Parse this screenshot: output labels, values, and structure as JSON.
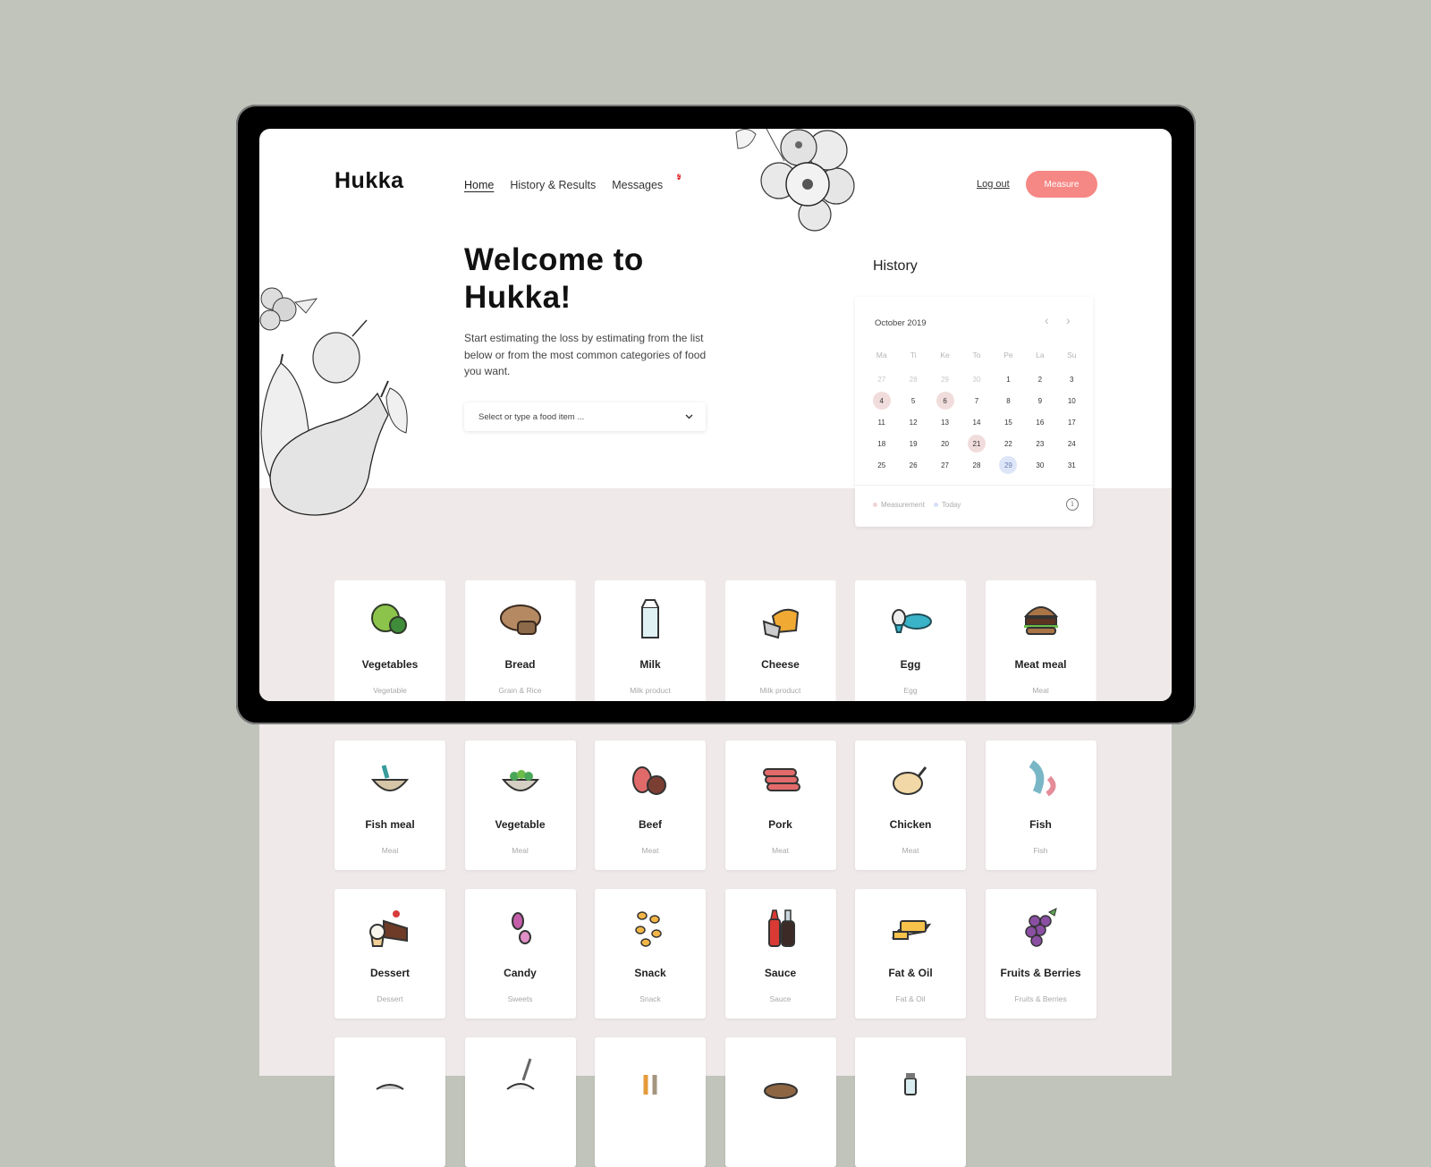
{
  "app": {
    "logo": "Hukka"
  },
  "nav": {
    "items": [
      {
        "label": "Home",
        "active": true
      },
      {
        "label": "History & Results",
        "active": false
      },
      {
        "label": "Messages",
        "active": false,
        "badge": "2"
      }
    ],
    "logout_label": "Log out",
    "measure_label": "Measure"
  },
  "hero": {
    "title": "Welcome to Hukka!",
    "intro": "Start estimating the loss by estimating from the list below or from the most common categories of food you want.",
    "select_placeholder": "Select or type a food item ..."
  },
  "history": {
    "title": "History",
    "month": "October 2019",
    "weekdays": [
      "Ma",
      "Ti",
      "Ke",
      "To",
      "Pe",
      "La",
      "Su"
    ],
    "days": [
      {
        "d": "27",
        "muted": true
      },
      {
        "d": "28",
        "muted": true
      },
      {
        "d": "29",
        "muted": true
      },
      {
        "d": "30",
        "muted": true
      },
      {
        "d": "1"
      },
      {
        "d": "2"
      },
      {
        "d": "3"
      },
      {
        "d": "4",
        "measurement": true
      },
      {
        "d": "5"
      },
      {
        "d": "6",
        "measurement": true
      },
      {
        "d": "7"
      },
      {
        "d": "8"
      },
      {
        "d": "9"
      },
      {
        "d": "10"
      },
      {
        "d": "11"
      },
      {
        "d": "12"
      },
      {
        "d": "13"
      },
      {
        "d": "14"
      },
      {
        "d": "15"
      },
      {
        "d": "16"
      },
      {
        "d": "17"
      },
      {
        "d": "18"
      },
      {
        "d": "19"
      },
      {
        "d": "20"
      },
      {
        "d": "21",
        "measurement": true
      },
      {
        "d": "22"
      },
      {
        "d": "23"
      },
      {
        "d": "24"
      },
      {
        "d": "25"
      },
      {
        "d": "26"
      },
      {
        "d": "27"
      },
      {
        "d": "28"
      },
      {
        "d": "29",
        "today": true
      },
      {
        "d": "30"
      },
      {
        "d": "31"
      }
    ],
    "legend": [
      {
        "label": "Measurement",
        "color": "#f1d3d3"
      },
      {
        "label": "Today",
        "color": "#d6e0f6"
      }
    ]
  },
  "categories": [
    {
      "name": "Vegetables",
      "category": "Vegetable",
      "icon": "cabbage-icon"
    },
    {
      "name": "Bread",
      "category": "Grain & Rice",
      "icon": "bread-icon"
    },
    {
      "name": "Milk",
      "category": "Milk product",
      "icon": "milk-carton-icon"
    },
    {
      "name": "Cheese",
      "category": "Milk product",
      "icon": "cheese-icon"
    },
    {
      "name": "Egg",
      "category": "Egg",
      "icon": "egg-icon"
    },
    {
      "name": "Meat meal",
      "category": "Meal",
      "icon": "burger-icon"
    },
    {
      "name": "Fish meal",
      "category": "Meal",
      "icon": "fish-bowl-icon"
    },
    {
      "name": "Vegetable",
      "category": "Meal",
      "icon": "salad-bowl-icon"
    },
    {
      "name": "Beef",
      "category": "Meat",
      "icon": "beef-icon"
    },
    {
      "name": "Pork",
      "category": "Meat",
      "icon": "sausage-icon"
    },
    {
      "name": "Chicken",
      "category": "Meat",
      "icon": "chicken-icon"
    },
    {
      "name": "Fish",
      "category": "Fish",
      "icon": "fish-icon"
    },
    {
      "name": "Dessert",
      "category": "Dessert",
      "icon": "cake-icon"
    },
    {
      "name": "Candy",
      "category": "Sweets",
      "icon": "candy-icon"
    },
    {
      "name": "Snack",
      "category": "Snack",
      "icon": "chips-icon"
    },
    {
      "name": "Sauce",
      "category": "Sauce",
      "icon": "sauce-bottle-icon"
    },
    {
      "name": "Fat & Oil",
      "category": "Fat & Oil",
      "icon": "butter-icon"
    },
    {
      "name": "Fruits & Berries",
      "category": "Fruits & Berries",
      "icon": "grapes-icon"
    },
    {
      "name": "",
      "category": "",
      "icon": "soup-icon"
    },
    {
      "name": "",
      "category": "",
      "icon": "rice-bowl-icon"
    },
    {
      "name": "",
      "category": "",
      "icon": "grain-icon"
    },
    {
      "name": "",
      "category": "",
      "icon": "potato-icon"
    },
    {
      "name": "",
      "category": "",
      "icon": "jar-icon"
    }
  ],
  "colors": {
    "accent": "#f58784",
    "background": "#c1c4bb",
    "band": "#efe9e9",
    "badge": "#e01c1c"
  }
}
